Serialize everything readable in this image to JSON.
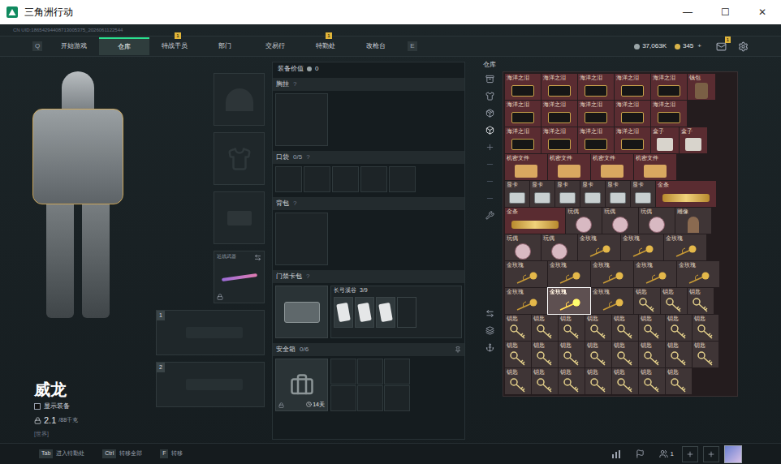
{
  "window": {
    "title": "三角洲行动",
    "controls": [
      "—",
      "☐",
      "✕"
    ]
  },
  "uid": "CN UID:18654294408713005375_2026061122544",
  "nav": {
    "prev_key": "Q",
    "next_key": "E",
    "tabs": [
      {
        "label": "开始游戏",
        "selected": false,
        "badge": ""
      },
      {
        "label": "仓库",
        "selected": true,
        "badge": ""
      },
      {
        "label": "特战干员",
        "selected": false,
        "badge": "1"
      },
      {
        "label": "部门",
        "selected": false,
        "badge": ""
      },
      {
        "label": "交易行",
        "selected": false,
        "badge": ""
      },
      {
        "label": "特勤处",
        "selected": false,
        "badge": "1"
      },
      {
        "label": "改枪台",
        "selected": false,
        "badge": ""
      }
    ]
  },
  "currency": {
    "coins": "37,063K",
    "tickets": "345",
    "add": "+",
    "mail_badge": "1"
  },
  "operator": {
    "name": "威龙",
    "show_gear": {
      "label": "显示装备",
      "checked": false
    },
    "weight": "2.1",
    "weight_max": "/88千克",
    "chat": "[世界]"
  },
  "gear_slots": [
    {
      "kind": "helmet",
      "label": "",
      "locked": false
    },
    {
      "kind": "armor",
      "label": "",
      "locked": false
    },
    {
      "kind": "pistol",
      "label": "",
      "locked": false
    },
    {
      "kind": "melee",
      "label": "近战武器",
      "locked": true
    }
  ],
  "weapon_slots": [
    {
      "number": "1"
    },
    {
      "number": "2"
    }
  ],
  "loadout": {
    "value_label": "装备价值",
    "value": "0",
    "chest": {
      "title": "胸挂",
      "help": "?"
    },
    "pocket": {
      "title": "口袋",
      "capacity": "0/5",
      "help": "?",
      "slots": [
        {
          "filled": false
        },
        {
          "filled": false
        },
        {
          "filled": false
        },
        {
          "filled": false
        },
        {
          "filled": false
        }
      ]
    },
    "backpack": {
      "title": "背包",
      "help": "?"
    },
    "keycard": {
      "title": "门禁卡包",
      "help": "?",
      "map": "长弓溪谷",
      "count": "3/9",
      "slots": [
        {
          "filled": true
        },
        {
          "filled": true
        },
        {
          "filled": true
        },
        {
          "filled": false
        }
      ]
    },
    "safe": {
      "title": "安全箱",
      "capacity": "0/6",
      "timer": "14天",
      "locked": true,
      "slots": [
        {
          "filled": false
        },
        {
          "filled": false
        },
        {
          "filled": false
        },
        {
          "filled": false
        },
        {
          "filled": false
        },
        {
          "filled": false
        }
      ]
    }
  },
  "storage": {
    "title": "仓库",
    "rows": [
      [
        {
          "name": "海洋之泪",
          "kind": "relic",
          "color": "#5a2c31",
          "selected": false
        },
        {
          "name": "海洋之泪",
          "kind": "relic",
          "color": "#5a2c31",
          "selected": false
        },
        {
          "name": "海洋之泪",
          "kind": "relic",
          "color": "#5a2c31",
          "selected": false
        },
        {
          "name": "海洋之泪",
          "kind": "relic",
          "color": "#5a2c31",
          "selected": false
        },
        {
          "name": "海洋之泪",
          "kind": "relic",
          "color": "#5a2c31",
          "selected": false
        },
        {
          "name": "钱包",
          "kind": "bag",
          "color": "#5a2c31",
          "selected": false
        }
      ],
      [
        {
          "name": "海洋之泪",
          "kind": "relic",
          "color": "#5a2c31",
          "selected": false
        },
        {
          "name": "海洋之泪",
          "kind": "relic",
          "color": "#5a2c31",
          "selected": false
        },
        {
          "name": "海洋之泪",
          "kind": "relic",
          "color": "#5a2c31",
          "selected": false
        },
        {
          "name": "海洋之泪",
          "kind": "relic",
          "color": "#5a2c31",
          "selected": false
        },
        {
          "name": "海洋之泪",
          "kind": "relic",
          "color": "#5a2c31",
          "selected": false
        }
      ],
      [
        {
          "name": "海洋之泪",
          "kind": "relic",
          "color": "#5a2c31",
          "selected": false
        },
        {
          "name": "海洋之泪",
          "kind": "relic",
          "color": "#5a2c31",
          "selected": false
        },
        {
          "name": "海洋之泪",
          "kind": "relic",
          "color": "#5a2c31",
          "selected": false
        },
        {
          "name": "海洋之泪",
          "kind": "relic",
          "color": "#5a2c31",
          "selected": false
        },
        {
          "name": "盒子",
          "kind": "box",
          "color": "#5a2c31",
          "selected": false
        },
        {
          "name": "盒子",
          "kind": "box",
          "color": "#5a2c31",
          "selected": false
        }
      ],
      [
        {
          "name": "机密文件",
          "kind": "paper",
          "color": "#5a2c31",
          "selected": false
        },
        {
          "name": "机密文件",
          "kind": "paper",
          "color": "#5a2c31",
          "selected": false
        },
        {
          "name": "机密文件",
          "kind": "paper",
          "color": "#5a2c31",
          "selected": false
        },
        {
          "name": "机密文件",
          "kind": "paper",
          "color": "#5a2c31",
          "selected": false
        }
      ],
      [
        {
          "name": "显卡",
          "kind": "device",
          "color": "#3f3536",
          "selected": false
        },
        {
          "name": "显卡",
          "kind": "device",
          "color": "#3f3536",
          "selected": false
        },
        {
          "name": "显卡",
          "kind": "device",
          "color": "#3f3536",
          "selected": false
        },
        {
          "name": "显卡",
          "kind": "device",
          "color": "#3f3536",
          "selected": false
        },
        {
          "name": "显卡",
          "kind": "device",
          "color": "#3f3536",
          "selected": false
        },
        {
          "name": "显卡",
          "kind": "device",
          "color": "#3f3536",
          "selected": false
        },
        {
          "name": "金条",
          "kind": "bar",
          "color": "#5a2c31",
          "selected": false
        }
      ],
      [
        {
          "name": "金条",
          "kind": "bar",
          "color": "#5a2c31",
          "selected": false
        },
        {
          "name": "玩偶",
          "kind": "doll",
          "color": "#3f3536",
          "selected": false
        },
        {
          "name": "玩偶",
          "kind": "doll",
          "color": "#3f3536",
          "selected": false
        },
        {
          "name": "玩偶",
          "kind": "doll",
          "color": "#3f3536",
          "selected": false
        },
        {
          "name": "雕像",
          "kind": "figure",
          "color": "#3f3536",
          "selected": false
        }
      ],
      [
        {
          "name": "玩偶",
          "kind": "doll",
          "color": "#3f3536",
          "selected": false
        },
        {
          "name": "玩偶",
          "kind": "doll",
          "color": "#3f3536",
          "selected": false
        },
        {
          "name": "金玫瑰",
          "kind": "rose",
          "color": "#3f3536",
          "selected": false
        },
        {
          "name": "金玫瑰",
          "kind": "rose",
          "color": "#3f3536",
          "selected": false
        },
        {
          "name": "金玫瑰",
          "kind": "rose",
          "color": "#3f3536",
          "selected": false
        }
      ],
      [
        {
          "name": "金玫瑰",
          "kind": "rose",
          "color": "#3f3536",
          "selected": false
        },
        {
          "name": "金玫瑰",
          "kind": "rose",
          "color": "#3f3536",
          "selected": false
        },
        {
          "name": "金玫瑰",
          "kind": "rose",
          "color": "#3f3536",
          "selected": false
        },
        {
          "name": "金玫瑰",
          "kind": "rose",
          "color": "#3f3536",
          "selected": false
        },
        {
          "name": "金玫瑰",
          "kind": "rose",
          "color": "#3f3536",
          "selected": false
        }
      ],
      [
        {
          "name": "金玫瑰",
          "kind": "rose",
          "color": "#3f3536",
          "selected": false
        },
        {
          "name": "金玫瑰",
          "kind": "rose",
          "color": "#3f3536",
          "selected": true
        },
        {
          "name": "金玫瑰",
          "kind": "rose",
          "color": "#3f3536",
          "selected": false
        },
        {
          "name": "钥匙",
          "kind": "key",
          "color": "#3f3536",
          "selected": false
        },
        {
          "name": "钥匙",
          "kind": "key",
          "color": "#3f3536",
          "selected": false
        },
        {
          "name": "钥匙",
          "kind": "key",
          "color": "#3f3536",
          "selected": false
        }
      ],
      [
        {
          "name": "钥匙",
          "kind": "key",
          "color": "#3f3536",
          "selected": false
        },
        {
          "name": "钥匙",
          "kind": "key",
          "color": "#3f3536",
          "selected": false
        },
        {
          "name": "钥匙",
          "kind": "key",
          "color": "#3f3536",
          "selected": false
        },
        {
          "name": "钥匙",
          "kind": "key",
          "color": "#3f3536",
          "selected": false
        },
        {
          "name": "钥匙",
          "kind": "key",
          "color": "#3f3536",
          "selected": false
        },
        {
          "name": "钥匙",
          "kind": "key",
          "color": "#3f3536",
          "selected": false
        },
        {
          "name": "钥匙",
          "kind": "key",
          "color": "#3f3536",
          "selected": false
        },
        {
          "name": "钥匙",
          "kind": "key",
          "color": "#3f3536",
          "selected": false
        }
      ],
      [
        {
          "name": "钥匙",
          "kind": "key",
          "color": "#3f3536",
          "selected": false
        },
        {
          "name": "钥匙",
          "kind": "key",
          "color": "#3f3536",
          "selected": false
        },
        {
          "name": "钥匙",
          "kind": "key",
          "color": "#3f3536",
          "selected": false
        },
        {
          "name": "钥匙",
          "kind": "key",
          "color": "#3f3536",
          "selected": false
        },
        {
          "name": "钥匙",
          "kind": "key",
          "color": "#3f3536",
          "selected": false
        },
        {
          "name": "钥匙",
          "kind": "key",
          "color": "#3f3536",
          "selected": false
        },
        {
          "name": "钥匙",
          "kind": "key",
          "color": "#3f3536",
          "selected": false
        },
        {
          "name": "钥匙",
          "kind": "key",
          "color": "#3f3536",
          "selected": false
        }
      ],
      [
        {
          "name": "钥匙",
          "kind": "key",
          "color": "#3f3536",
          "selected": false
        },
        {
          "name": "钥匙",
          "kind": "key",
          "color": "#3f3536",
          "selected": false
        },
        {
          "name": "钥匙",
          "kind": "key",
          "color": "#3f3536",
          "selected": false
        },
        {
          "name": "钥匙",
          "kind": "key",
          "color": "#3f3536",
          "selected": false
        },
        {
          "name": "钥匙",
          "kind": "key",
          "color": "#3f3536",
          "selected": false
        },
        {
          "name": "钥匙",
          "kind": "key",
          "color": "#3f3536",
          "selected": false
        },
        {
          "name": "钥匙",
          "kind": "key",
          "color": "#3f3536",
          "selected": false
        }
      ]
    ]
  },
  "hints": [
    {
      "key": "Tab",
      "label": "进入特勤处"
    },
    {
      "key": "Ctrl",
      "label": "转移全部"
    },
    {
      "key": "F",
      "label": "转移"
    }
  ],
  "party": {
    "count": "1"
  }
}
